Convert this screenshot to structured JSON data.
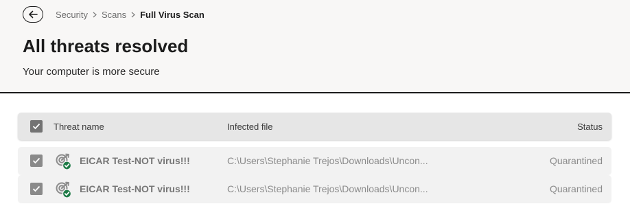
{
  "header": {
    "back_icon": "arrow-left-icon",
    "breadcrumb": {
      "items": [
        "Security",
        "Scans"
      ],
      "current": "Full Virus Scan"
    },
    "title": "All threats resolved",
    "subtitle": "Your computer is more secure"
  },
  "table": {
    "columns": {
      "name": "Threat name",
      "file": "Infected file",
      "status": "Status"
    },
    "rows": [
      {
        "name": "EICAR Test-NOT virus!!!",
        "file": "C:\\Users\\Stephanie Trejos\\Downloads\\Uncon...",
        "status": "Quarantined",
        "checked": true,
        "icon": "quarantined-threat-icon"
      },
      {
        "name": "EICAR Test-NOT virus!!!",
        "file": "C:\\Users\\Stephanie Trejos\\Downloads\\Uncon...",
        "status": "Quarantined",
        "checked": true,
        "icon": "quarantined-threat-icon"
      }
    ]
  },
  "colors": {
    "header_bg": "#f8f7f6",
    "table_header_bg": "#e6e6e6",
    "row_bg": "#f2f2f2",
    "checkbox": "#8a8a8a",
    "resolved_badge": "#1e7b46"
  }
}
